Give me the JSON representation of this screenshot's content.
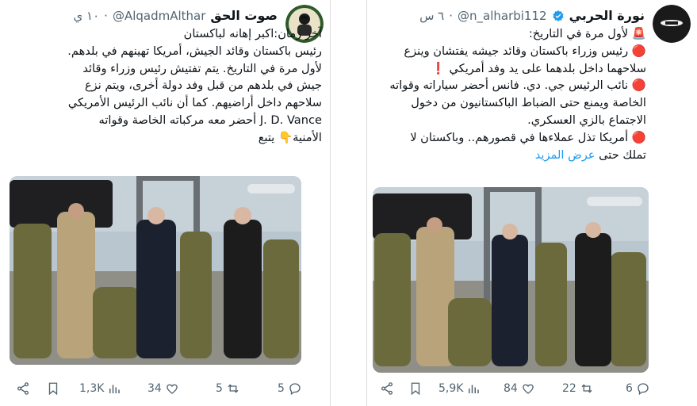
{
  "left_post": {
    "display_name": "صوت الحق",
    "handle": "@AlqadmAlthar",
    "separator": "·",
    "time": "١٠ ي",
    "text": "آخر زمان:اكبر إهانه لباكستان\nرئيس باكستان وقائد الجيش، أمريكا تهينهم في بلدهم.\nلأول مرة في التاريخ. يتم تفتيش رئيس وزراء وقائد\nجيش في بلدهم من قبل وفد دولة أخرى، ويتم نزع\nسلاحهم داخل أراضيهم. كما أن نائب الرئيس الأمريكي\nJ. D. Vance أحضر معه مركباته الخاصة وقواته\nالأمنية👇 يتبع",
    "actions": {
      "replies": "5",
      "reposts": "5",
      "likes": "34",
      "views": "1,3K"
    }
  },
  "right_post": {
    "display_name": "نورة الحربي",
    "handle": "@n_alharbi112",
    "separator": "·",
    "time": "٦ س",
    "text": "🚨 لأول مرة في التاريخ:\n🔴 رئيس وزراء باكستان وقائد جيشه يفتشان وينزع\nسلاحهما داخل بلدهما على يد وفد أمريكي ❗\n🔴 نائب الرئيس جي. دي. فانس أحضر سياراته وقواته\nالخاصة ويمنع حتى الضباط الباكستانيون من دخول\nالاجتماع بالزي العسكري.\n🔴 أمريكا تذل عملاءها في قصورهم.. وباكستان لا\nتملك حتى ",
    "show_more": "عرض المزيد",
    "actions": {
      "replies": "6",
      "reposts": "22",
      "likes": "84",
      "views": "5,9K"
    }
  },
  "colors": {
    "link": "#1d9bf0",
    "muted": "#536471",
    "verified": "#1d9bf0"
  }
}
